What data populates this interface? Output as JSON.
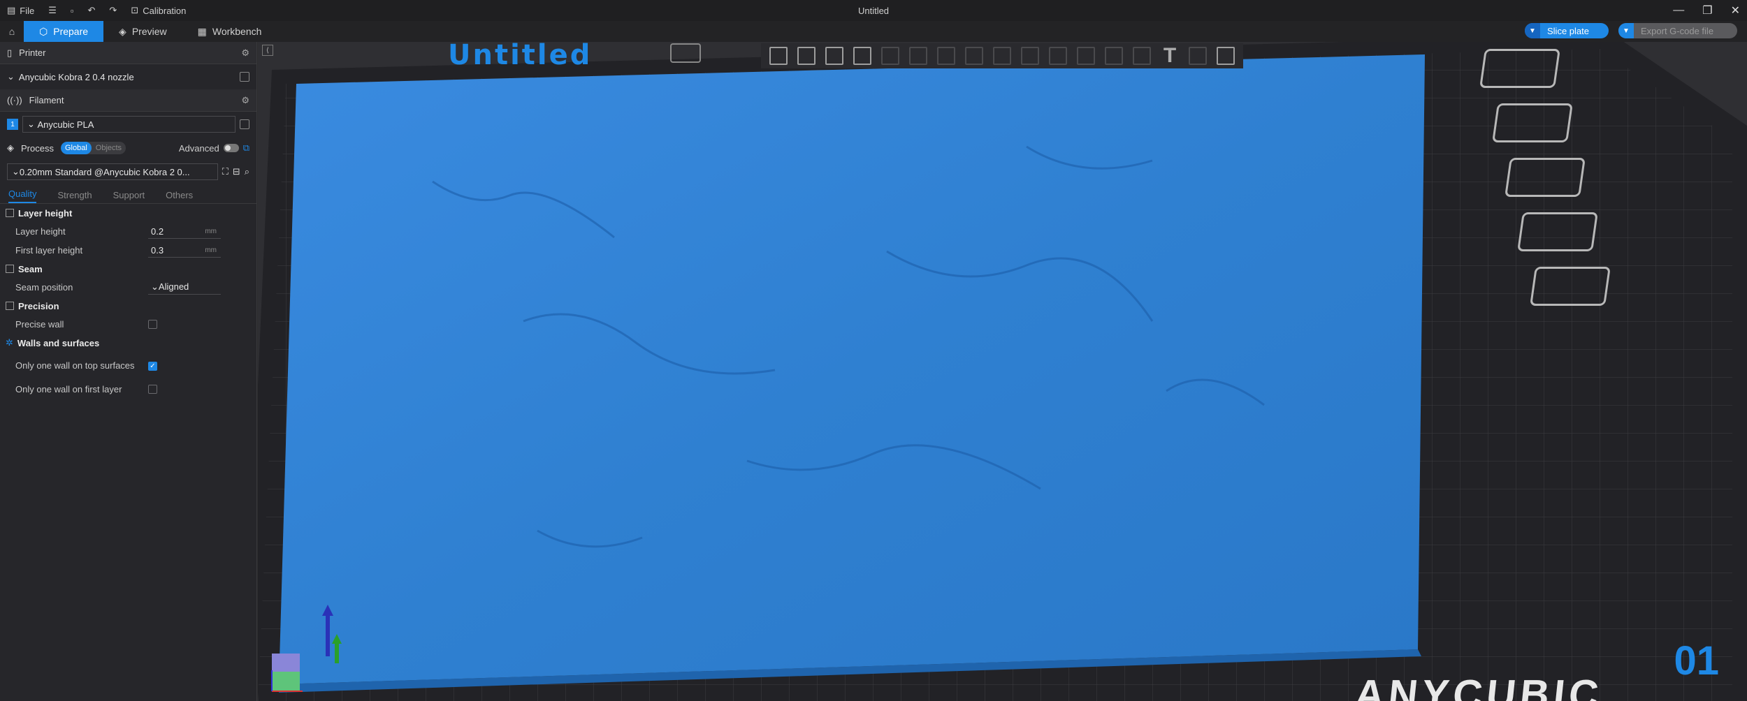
{
  "titlebar": {
    "file_label": "File",
    "calibration_label": "Calibration",
    "window_title": "Untitled"
  },
  "tabs": [
    {
      "label": "Prepare",
      "active": true
    },
    {
      "label": "Preview",
      "active": false
    },
    {
      "label": "Workbench",
      "active": false
    }
  ],
  "actions": {
    "slice_label": "Slice plate",
    "export_label": "Export G-code file"
  },
  "sidebar": {
    "printer": {
      "header": "Printer",
      "value": "Anycubic Kobra 2 0.4 nozzle"
    },
    "filament": {
      "header": "Filament",
      "slot": "1",
      "value": "Anycubic PLA"
    },
    "process": {
      "header": "Process",
      "global": "Global",
      "objects": "Objects",
      "advanced": "Advanced",
      "preset": "0.20mm Standard @Anycubic Kobra 2 0..."
    },
    "subtabs": [
      "Quality",
      "Strength",
      "Support",
      "Others"
    ],
    "groups": {
      "layer_height": {
        "title": "Layer height",
        "layer_height_label": "Layer height",
        "layer_height_value": "0.2",
        "layer_height_unit": "mm",
        "first_layer_label": "First layer height",
        "first_layer_value": "0.3",
        "first_layer_unit": "mm"
      },
      "seam": {
        "title": "Seam",
        "position_label": "Seam position",
        "position_value": "Aligned"
      },
      "precision": {
        "title": "Precision",
        "precise_wall_label": "Precise wall",
        "precise_wall_checked": false
      },
      "walls": {
        "title": "Walls and surfaces",
        "top_label": "Only one wall on top surfaces",
        "top_checked": true,
        "first_label": "Only one wall on first layer",
        "first_checked": false
      }
    }
  },
  "viewport": {
    "plate_name": "Untitled",
    "plate_number": "01",
    "bed_brand": "ANYCUBIC",
    "model_color": "#2f80d1",
    "accent": "#1e88e5"
  }
}
